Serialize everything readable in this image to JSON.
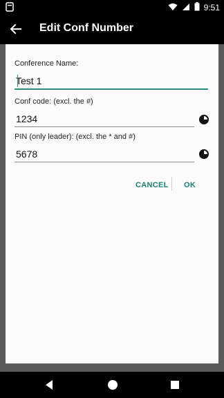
{
  "status_bar": {
    "time": "9:51"
  },
  "app_bar": {
    "title": "Edit Conf Number"
  },
  "form": {
    "conference_name": {
      "label": "Conference Name:",
      "value": "Test 1"
    },
    "conf_code": {
      "label": "Conf code: (excl. the #)",
      "value": "1234"
    },
    "pin": {
      "label": "PIN (only leader): (excl. the * and #)",
      "value": "5678"
    }
  },
  "buttons": {
    "cancel": "CANCEL",
    "ok": "OK"
  },
  "colors": {
    "accent": "#2a8a7a",
    "button_text": "#1b7f73",
    "background": "#fafafa"
  }
}
